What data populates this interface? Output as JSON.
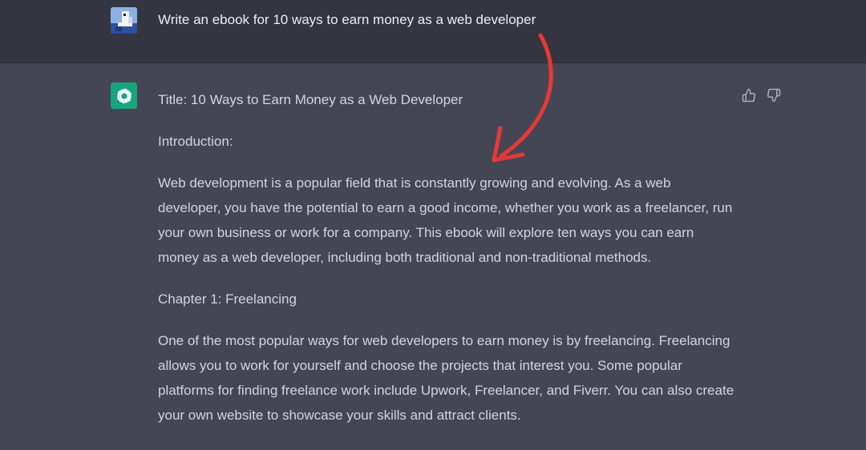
{
  "conversation": {
    "user_message": "Write an ebook for 10 ways to earn money as a web developer",
    "assistant_paragraphs": [
      "Title: 10 Ways to Earn Money as a Web Developer",
      "Introduction:",
      "Web development is a popular field that is constantly growing and evolving. As a web developer, you have the potential to earn a good income, whether you work as a freelancer, run your own business or work for a company. This ebook will explore ten ways you can earn money as a web developer, including both traditional and non-traditional methods.",
      "Chapter 1: Freelancing",
      "One of the most popular ways for web developers to earn money is by freelancing. Freelancing allows you to work for yourself and choose the projects that interest you. Some popular platforms for finding freelance work include Upwork, Freelancer, and Fiverr. You can also create your own website to showcase your skills and attract clients."
    ]
  },
  "icons": {
    "user_avatar": "user-avatar-icon",
    "assistant_avatar": "openai-logo-icon",
    "thumbs_up": "thumbs-up-icon",
    "thumbs_down": "thumbs-down-icon"
  },
  "colors": {
    "user_row_bg": "#343541",
    "assistant_row_bg": "#444654",
    "assistant_avatar_bg": "#19a37f",
    "annotation_arrow": "#e53935"
  }
}
